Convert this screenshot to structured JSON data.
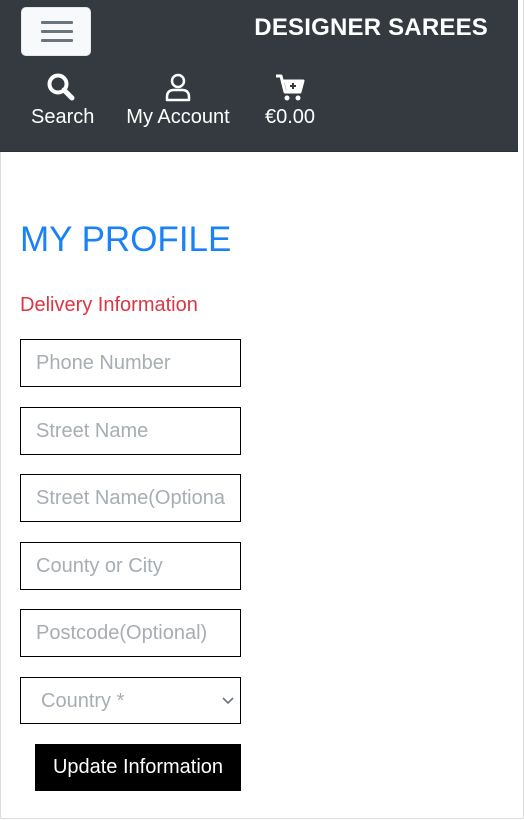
{
  "navbar": {
    "brand": "DESIGNER SAREES",
    "menu_icon": "hamburger-menu-icon",
    "items": [
      {
        "label": "Search",
        "icon": "search-icon"
      },
      {
        "label": "My Account",
        "icon": "user-icon"
      },
      {
        "label": "€0.00",
        "icon": "cart-icon"
      }
    ]
  },
  "main": {
    "title": "MY PROFILE",
    "section_title": "Delivery Information",
    "fields": {
      "phone": {
        "placeholder": "Phone Number",
        "value": ""
      },
      "street1": {
        "placeholder": "Street Name",
        "value": ""
      },
      "street2": {
        "placeholder": "Street Name(Optional)",
        "value": ""
      },
      "county": {
        "placeholder": "County or City",
        "value": ""
      },
      "postcode": {
        "placeholder": "Postcode(Optional)",
        "value": ""
      }
    },
    "country_select": {
      "selected": "Country *",
      "icon": "chevron-down-icon"
    },
    "update_button": "Update Information"
  },
  "colors": {
    "navbar_bg": "#343a40",
    "title_blue": "#1a82f7",
    "section_red": "#dc3545",
    "placeholder_gray": "#a6adb4"
  }
}
